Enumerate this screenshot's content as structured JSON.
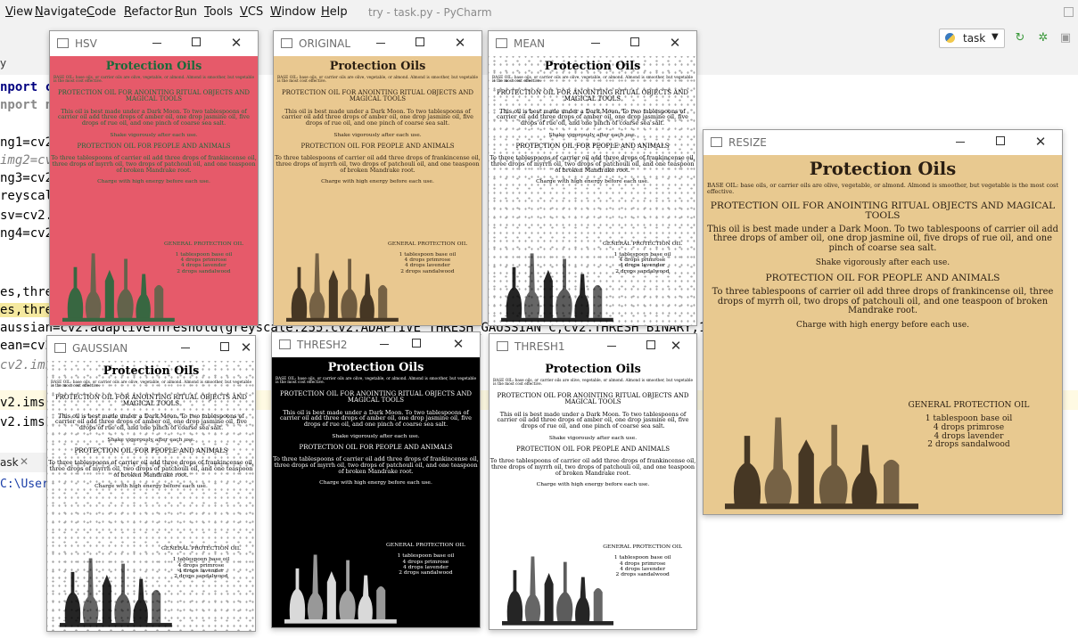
{
  "menubar": {
    "items": [
      "View",
      "Navigate",
      "Code",
      "Refactor",
      "Run",
      "Tools",
      "VCS",
      "Window",
      "Help"
    ],
    "window_title": "try - task.py - PyCharm"
  },
  "toolbar": {
    "run_config": "task"
  },
  "editor": {
    "tab_file": "y",
    "code_lines": [
      "nport cv",
      "nport n",
      "",
      "ng1=cv2.",
      "img2=cv2",
      "ng3=cv2.",
      "reyscale",
      "sv=cv2.c",
      "ng4=cv2.",
      "",
      "",
      "es,thres",
      "es,thres",
      "aussian=cv2.adaptiveThreshold(greyscale,255,cv2.ADAPTIVE_THRESH_GAUSSIAN_C,cv2.THRESH_BINARY,155,1)",
      "ean=cv2.",
      "cv2.imsh",
      "",
      "v2.imsh",
      "v2.imsh"
    ]
  },
  "bottom": {
    "run_tab": "ask",
    "console_line": "C:\\User"
  },
  "recipe": {
    "title": "Protection Oils",
    "base": "BASE OIL: base oils, or carrier oils are olive, vegetable, or almond. Almond is smoother, but vegetable is the most cost effective.",
    "head1": "PROTECTION OIL FOR ANOINTING RITUAL OBJECTS AND MAGICAL TOOLS",
    "body1": "This oil is best made under a Dark Moon. To two tablespoons of carrier oil add three drops of amber oil, one drop jasmine oil, five drops of rue oil, and one pinch of coarse sea salt.",
    "shake": "Shake vigorously after each use.",
    "head2": "PROTECTION OIL FOR PEOPLE AND ANIMALS",
    "body2": "To three tablespoons of carrier oil add three drops of frankincense oil, three drops of myrrh oil, two drops of patchouli oil, and one teaspoon of broken Mandrake root.",
    "charge": "Charge with high energy before each use.",
    "general": "GENERAL PROTECTION OIL",
    "ingredients": [
      "1 tablespoon base oil",
      "4 drops primrose",
      "4 drops lavender",
      "2 drops sandalwood"
    ]
  },
  "windows": {
    "hsv": "HSV",
    "original": "ORIGINAL",
    "mean": "MEAN",
    "resize": "RESIZE",
    "gaussian": "GAUSSIAN",
    "thresh2": "THRESH2",
    "thresh1": "THRESH1"
  },
  "colors": {
    "hsv_bg": "#e65a6a",
    "parchment": "#e9c890",
    "threshold_white": "#ffffff",
    "threshold_black": "#000000"
  }
}
